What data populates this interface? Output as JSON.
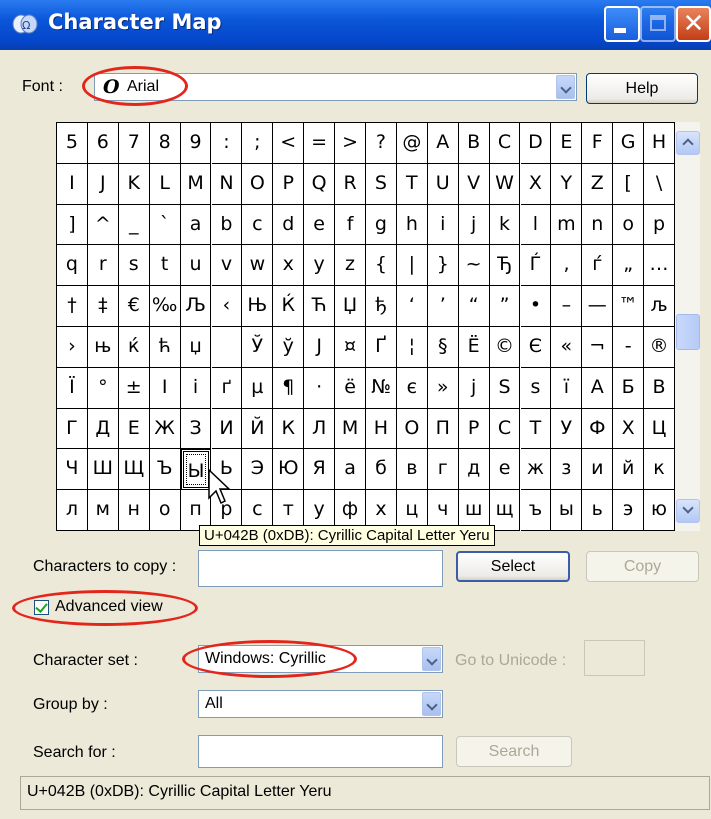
{
  "window": {
    "title": "Character Map"
  },
  "font": {
    "label": "Font :",
    "value": "Arial",
    "font_icon_glyph": "O",
    "help_button": "Help"
  },
  "grid": {
    "rows": [
      [
        "5",
        "6",
        "7",
        "8",
        "9",
        ":",
        ";",
        "<",
        "=",
        ">",
        "?",
        "@",
        "A",
        "B",
        "C",
        "D",
        "E",
        "F",
        "G",
        "H"
      ],
      [
        "I",
        "J",
        "K",
        "L",
        "M",
        "N",
        "O",
        "P",
        "Q",
        "R",
        "S",
        "T",
        "U",
        "V",
        "W",
        "X",
        "Y",
        "Z",
        "[",
        "\\"
      ],
      [
        "]",
        "^",
        "_",
        "`",
        "a",
        "b",
        "c",
        "d",
        "e",
        "f",
        "g",
        "h",
        "i",
        "j",
        "k",
        "l",
        "m",
        "n",
        "o",
        "p"
      ],
      [
        "q",
        "r",
        "s",
        "t",
        "u",
        "v",
        "w",
        "x",
        "y",
        "z",
        "{",
        "|",
        "}",
        "~",
        "Ђ",
        "Ѓ",
        "‚",
        "ѓ",
        "„",
        "…"
      ],
      [
        "†",
        "‡",
        "€",
        "‰",
        "Љ",
        "‹",
        "Њ",
        "Ќ",
        "Ћ",
        "Џ",
        "ђ",
        "‘",
        "’",
        "“",
        "”",
        "•",
        "–",
        "—",
        "™",
        "љ"
      ],
      [
        "›",
        "њ",
        "ќ",
        "ћ",
        "џ",
        " ",
        "Ў",
        "ў",
        "Ј",
        "¤",
        "Ґ",
        "¦",
        "§",
        "Ё",
        "©",
        "Є",
        "«",
        "¬",
        "-",
        "®"
      ],
      [
        "Ї",
        "°",
        "±",
        "І",
        "і",
        "ґ",
        "µ",
        "¶",
        "·",
        "ё",
        "№",
        "є",
        "»",
        "ј",
        "Ѕ",
        "ѕ",
        "ї",
        "А",
        "Б",
        "В"
      ],
      [
        "Г",
        "Д",
        "Е",
        "Ж",
        "З",
        "И",
        "Й",
        "К",
        "Л",
        "М",
        "Н",
        "О",
        "П",
        "Р",
        "С",
        "Т",
        "У",
        "Ф",
        "Х",
        "Ц"
      ],
      [
        "Ч",
        "Ш",
        "Щ",
        "Ъ",
        "Ы",
        "Ь",
        "Э",
        "Ю",
        "Я",
        "а",
        "б",
        "в",
        "г",
        "д",
        "е",
        "ж",
        "з",
        "и",
        "й",
        "к"
      ],
      [
        "л",
        "м",
        "н",
        "о",
        "п",
        "р",
        "с",
        "т",
        "у",
        "ф",
        "х",
        "ц",
        "ч",
        "ш",
        "щ",
        "ъ",
        "ы",
        "ь",
        "э",
        "ю"
      ]
    ],
    "selected": {
      "row": 8,
      "col": 4
    }
  },
  "tooltip": "U+042B (0xDB): Cyrillic Capital Letter Yeru",
  "copy": {
    "label": "Characters to copy :",
    "value": "",
    "select_button": "Select",
    "copy_button": "Copy"
  },
  "advanced_view": {
    "label": "Advanced view",
    "checked": true
  },
  "character_set": {
    "label": "Character set :",
    "value": "Windows: Cyrillic",
    "go_to_unicode_label": "Go to Unicode :",
    "go_to_unicode_value": ""
  },
  "group_by": {
    "label": "Group by :",
    "value": "All"
  },
  "search": {
    "label": "Search for :",
    "value": "",
    "button": "Search"
  },
  "status": "U+042B (0xDB): Cyrillic Capital Letter Yeru",
  "colors": {
    "title_bar": "#0A56D8",
    "highlight_ellipse": "#E3261C",
    "dialog_bg": "#ECE9D8",
    "tooltip_bg": "#FFFFE1"
  }
}
